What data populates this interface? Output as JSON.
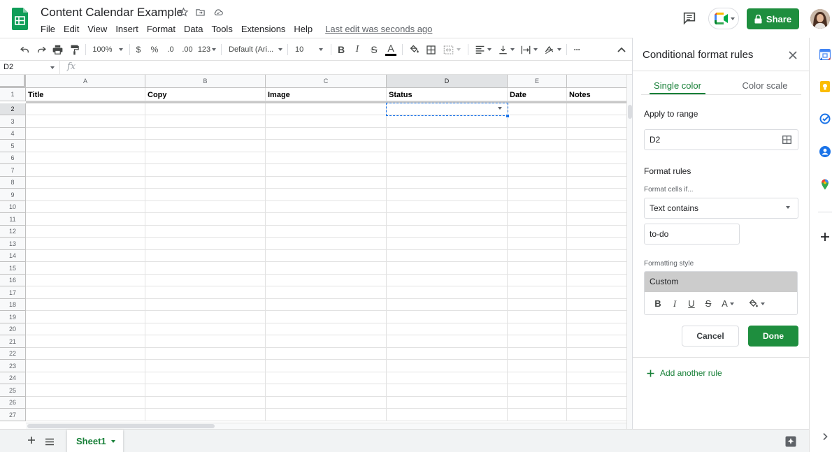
{
  "app": {
    "doc_title": "Content Calendar Example",
    "menu": [
      "File",
      "Edit",
      "View",
      "Insert",
      "Format",
      "Data",
      "Tools",
      "Extensions",
      "Help"
    ],
    "last_edit": "Last edit was seconds ago",
    "share_label": "Share",
    "brand_color": "#1e8e3e"
  },
  "toolbar": {
    "zoom": "100%",
    "currency": "$",
    "percent": "%",
    "decrease_decimal": ".0",
    "increase_decimal": ".00",
    "more_formats": "123",
    "font": "Default (Ari...",
    "font_size": "10",
    "bold": "B",
    "italic": "I",
    "strike": "S",
    "text_color": "A",
    "more": "···"
  },
  "formula_bar": {
    "name_box": "D2",
    "fx": "fx"
  },
  "grid": {
    "columns": [
      "A",
      "B",
      "C",
      "D",
      "E"
    ],
    "header_row": [
      "Title",
      "Copy",
      "Image",
      "Status",
      "Date",
      "Notes"
    ],
    "row_numbers": [
      "1",
      "2",
      "3",
      "4",
      "5",
      "6",
      "7",
      "8",
      "9",
      "10",
      "11",
      "12",
      "13",
      "14",
      "15",
      "16",
      "17",
      "18",
      "19",
      "20",
      "21",
      "22",
      "23",
      "24",
      "25",
      "26",
      "27"
    ],
    "selected_cell": "D2"
  },
  "sheet_tabs": {
    "active": "Sheet1"
  },
  "panel": {
    "title": "Conditional format rules",
    "tab_single": "Single color",
    "tab_scale": "Color scale",
    "apply_label": "Apply to range",
    "range_value": "D2",
    "rules_label": "Format rules",
    "cells_if_label": "Format cells if...",
    "condition": "Text contains",
    "condition_value": "to-do",
    "style_label": "Formatting style",
    "style_name": "Custom",
    "style_tools": {
      "bold": "B",
      "italic": "I",
      "underline": "U",
      "strike": "S",
      "text_color": "A"
    },
    "cancel_label": "Cancel",
    "done_label": "Done",
    "add_rule_label": "Add another rule"
  }
}
